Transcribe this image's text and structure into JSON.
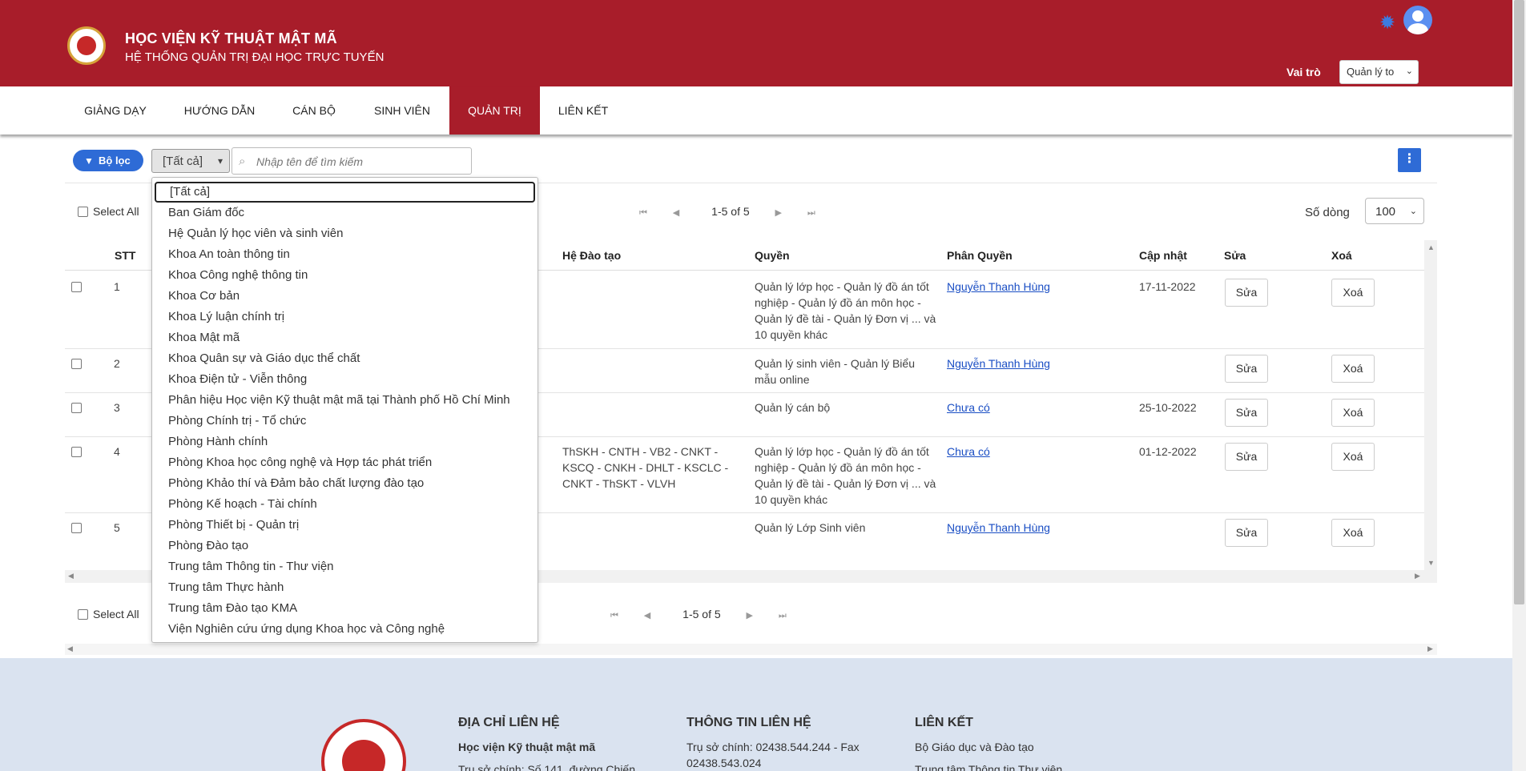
{
  "header": {
    "title": "HỌC VIỆN KỸ THUẬT MẬT MÃ",
    "subtitle": "HỆ THỐNG QUẢN TRỊ ĐẠI HỌC TRỰC TUYẾN",
    "role_label": "Vai trò",
    "role_value": "Quản lý to"
  },
  "nav": {
    "items": [
      "GIẢNG DẠY",
      "HƯỚNG DẪN",
      "CÁN BỘ",
      "SINH VIÊN",
      "QUẢN TRỊ",
      "LIÊN KẾT"
    ],
    "active": "QUẢN TRỊ"
  },
  "toolbar": {
    "filter_label": "Bộ lọc",
    "dept_value": "[Tất cả]",
    "search_placeholder": "Nhập tên để tìm kiếm",
    "menu_glyph": "⋮"
  },
  "grid": {
    "select_all": "Select All",
    "pager_text": "1-5 of 5",
    "rows_label": "Số dòng",
    "rows_value": "100",
    "columns": [
      "STT",
      "Hệ Đào tạo",
      "Quyền",
      "Phân Quyền",
      "Cập nhật",
      "Sửa",
      "Xoá"
    ],
    "rows": [
      {
        "stt": "1",
        "he_dao_tao": "",
        "quyen": "Quản lý lớp học - Quản lý đồ án tốt nghiệp - Quản lý đồ án môn học - Quản lý đề tài - Quản lý Đơn vị ... và 10 quyền khác",
        "phan_quyen": "Nguyễn Thanh Hùng",
        "cap_nhat": "17-11-2022"
      },
      {
        "stt": "2",
        "he_dao_tao": "",
        "quyen": "Quản lý sinh viên - Quản lý Biểu mẫu online",
        "phan_quyen": "Nguyễn Thanh Hùng",
        "cap_nhat": ""
      },
      {
        "stt": "3",
        "he_dao_tao": "",
        "quyen": "Quản lý cán bộ",
        "phan_quyen": "Chưa có",
        "cap_nhat": "25-10-2022"
      },
      {
        "stt": "4",
        "he_dao_tao": "ThSKH - CNTH - VB2 - CNKT - KSCQ - CNKH - DHLT - KSCLC - CNKT - ThSKT - VLVH",
        "quyen": "Quản lý lớp học - Quản lý đồ án tốt nghiệp - Quản lý đồ án môn học - Quản lý đề tài - Quản lý Đơn vị ... và 10 quyền khác",
        "phan_quyen": "Chưa có",
        "cap_nhat": "01-12-2022"
      },
      {
        "stt": "5",
        "he_dao_tao": "",
        "quyen": "Quản lý Lớp Sinh viên",
        "phan_quyen": "Nguyễn Thanh Hùng",
        "cap_nhat": ""
      }
    ],
    "edit_label": "Sửa",
    "delete_label": "Xoá"
  },
  "dropdown": {
    "options": [
      "[Tất cả]",
      "Ban Giám đốc",
      "Hệ Quản lý học viên và sinh viên",
      "Khoa An toàn thông tin",
      "Khoa Công nghệ thông tin",
      "Khoa Cơ bản",
      "Khoa Lý luận chính trị",
      "Khoa Mật mã",
      "Khoa Quân sự và Giáo dục thể chất",
      "Khoa Điện tử - Viễn thông",
      "Phân hiệu Học viện Kỹ thuật mật mã tại Thành phố Hồ Chí Minh",
      "Phòng Chính trị - Tổ chức",
      "Phòng Hành chính",
      "Phòng Khoa học công nghệ và Hợp tác phát triển",
      "Phòng Khảo thí và Đảm bảo chất lượng đào tạo",
      "Phòng Kế hoạch - Tài chính",
      "Phòng Thiết bị - Quản trị",
      "Phòng Đào tạo",
      "Trung tâm Thông tin - Thư viện",
      "Trung tâm Thực hành",
      "Trung tâm Đào tạo KMA",
      "Viện Nghiên cứu ứng dụng Khoa học và Công nghệ"
    ],
    "selected": "[Tất cả]"
  },
  "footer": {
    "col1_title": "ĐỊA CHỈ LIÊN HỆ",
    "col1_line1": "Học viện Kỹ thuật mật mã",
    "col1_line2": "Trụ sở chính: Số 141, đường Chiến",
    "col2_title": "THÔNG TIN LIÊN HỆ",
    "col2_line1": "Trụ sở chính: 02438.544.244 - Fax",
    "col2_line2": "02438.543.024",
    "col3_title": "LIÊN KẾT",
    "col3_line1": "Bộ Giáo dục và Đào tạo",
    "col3_line2": "Trung tâm Thông tin Thư viện"
  },
  "colors": {
    "brand_red": "#a81d2a",
    "accent_blue": "#2e6bd6",
    "link_blue": "#1a4ec4",
    "footer_bg": "#dae3f0"
  },
  "icons": [
    "gear-icon",
    "user-avatar-icon",
    "filter-icon",
    "search-icon",
    "chevron-down-icon",
    "more-vertical-icon",
    "first-page-icon",
    "prev-page-icon",
    "next-page-icon",
    "last-page-icon"
  ]
}
